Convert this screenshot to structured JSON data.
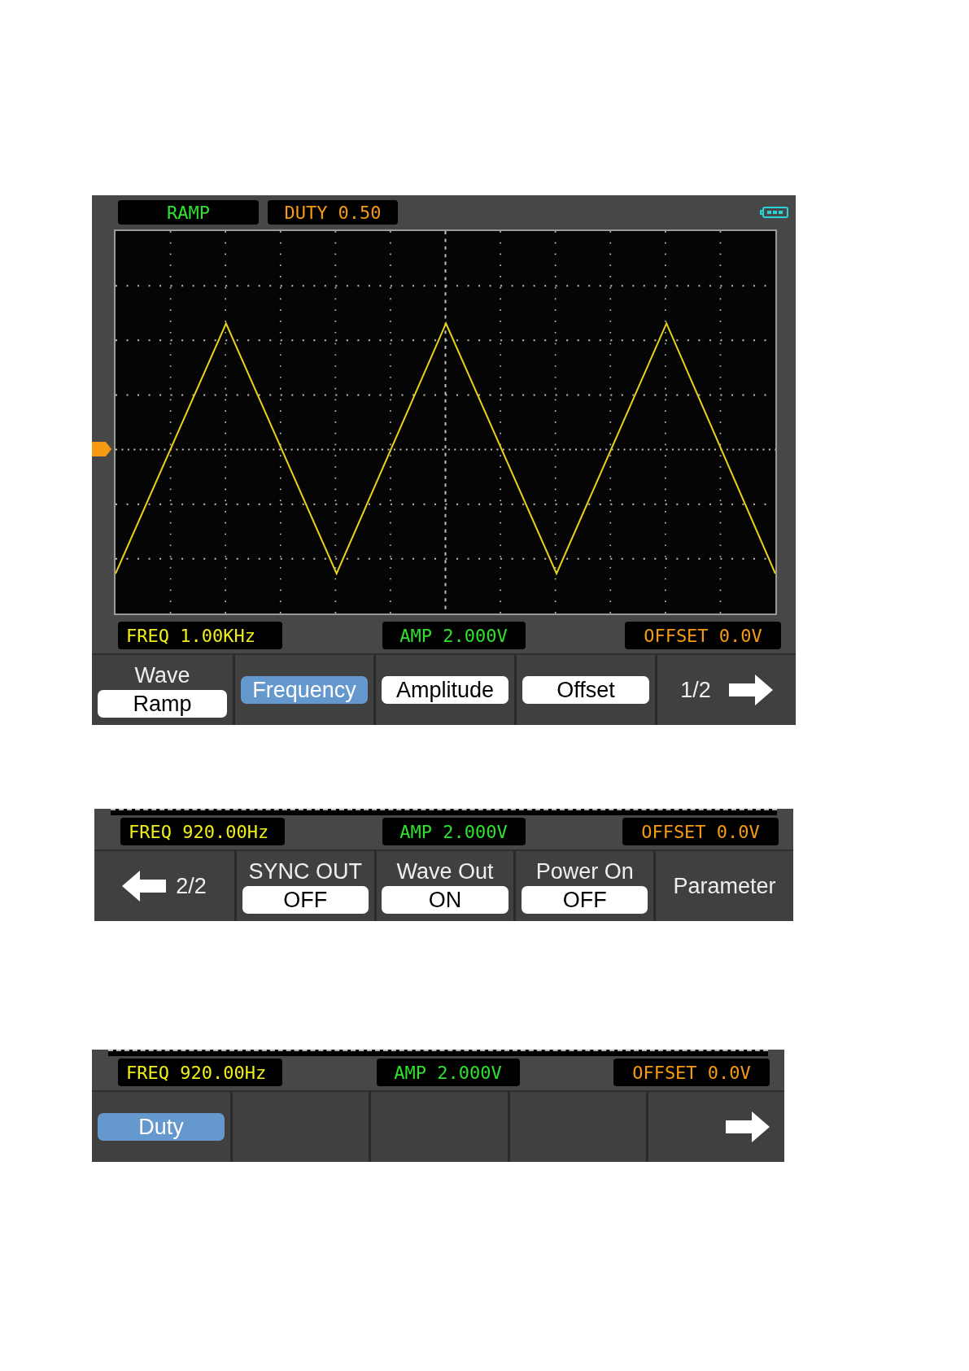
{
  "screens": [
    {
      "kind": "full",
      "mode": "RAMP",
      "duty": "DUTY 0.50",
      "status": {
        "freq": "FREQ 1.00KHz",
        "amp": "AMP 2.000V",
        "offset": "OFFSET 0.0V"
      },
      "menu": [
        {
          "kind": "option",
          "title": "Wave",
          "value": "Ramp"
        },
        {
          "kind": "button",
          "label": "Frequency",
          "selected": true
        },
        {
          "kind": "button",
          "label": "Amplitude",
          "selected": false
        },
        {
          "kind": "button",
          "label": "Offset",
          "selected": false
        },
        {
          "kind": "next_page",
          "page": "1/2"
        }
      ]
    },
    {
      "kind": "strip",
      "status": {
        "freq": "FREQ 920.00Hz",
        "amp": "AMP 2.000V",
        "offset": "OFFSET 0.0V"
      },
      "menu": [
        {
          "kind": "prev_page",
          "page": "2/2"
        },
        {
          "kind": "option",
          "title": "SYNC OUT",
          "value": "OFF"
        },
        {
          "kind": "option",
          "title": "Wave Out",
          "value": "ON"
        },
        {
          "kind": "option",
          "title": "Power On",
          "value": "OFF"
        },
        {
          "kind": "label",
          "label": "Parameter"
        }
      ]
    },
    {
      "kind": "strip",
      "status": {
        "freq": "FREQ 920.00Hz",
        "amp": "AMP 2.000V",
        "offset": "OFFSET 0.0V"
      },
      "menu": [
        {
          "kind": "button",
          "label": "Duty",
          "selected": true
        },
        {
          "kind": "empty"
        },
        {
          "kind": "empty"
        },
        {
          "kind": "empty"
        },
        {
          "kind": "next_page"
        }
      ]
    }
  ]
}
